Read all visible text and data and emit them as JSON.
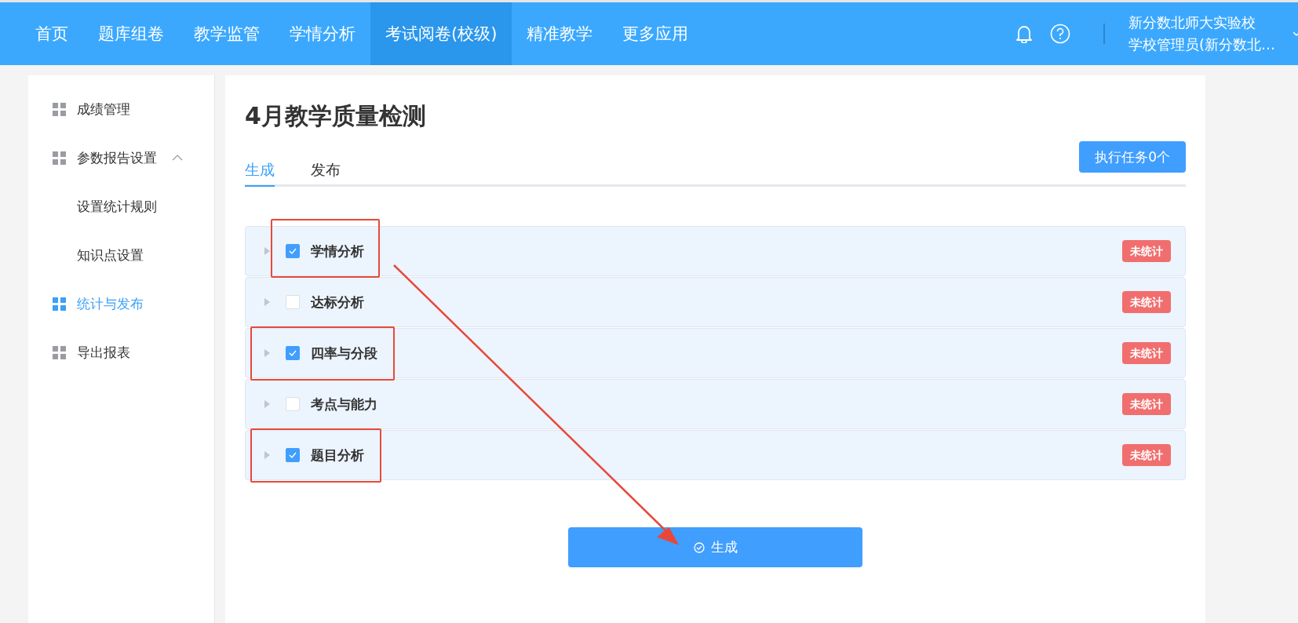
{
  "nav": {
    "items": [
      {
        "label": "首页",
        "selected": false
      },
      {
        "label": "题库组卷",
        "selected": false
      },
      {
        "label": "教学监管",
        "selected": false
      },
      {
        "label": "学情分析",
        "selected": false
      },
      {
        "label": "考试阅卷(校级)",
        "selected": true
      },
      {
        "label": "精准教学",
        "selected": false
      },
      {
        "label": "更多应用",
        "selected": false
      }
    ],
    "school": "新分数北师大实验校",
    "user": "学校管理员(新分数北…"
  },
  "sidebar": {
    "items": [
      {
        "label": "成绩管理",
        "selected": false
      },
      {
        "label": "参数报告设置",
        "selected": false,
        "expanded": true,
        "children": [
          {
            "label": "设置统计规则",
            "selected": false
          },
          {
            "label": "知识点设置",
            "selected": false
          }
        ]
      },
      {
        "label": "统计与发布",
        "selected": true
      },
      {
        "label": "导出报表",
        "selected": false
      }
    ]
  },
  "page": {
    "title": "4月教学质量检测",
    "tabs": [
      {
        "label": "生成",
        "selected": true
      },
      {
        "label": "发布",
        "selected": false
      }
    ],
    "task_button": "执行任务0个",
    "rows": [
      {
        "label": "学情分析",
        "checked": true,
        "highlighted": true,
        "status": "未统计"
      },
      {
        "label": "达标分析",
        "checked": false,
        "highlighted": false,
        "status": "未统计"
      },
      {
        "label": "四率与分段",
        "checked": true,
        "highlighted": true,
        "status": "未统计"
      },
      {
        "label": "考点与能力",
        "checked": false,
        "highlighted": false,
        "status": "未统计"
      },
      {
        "label": "题目分析",
        "checked": true,
        "highlighted": true,
        "status": "未统计"
      }
    ],
    "generate_button": "生成"
  }
}
